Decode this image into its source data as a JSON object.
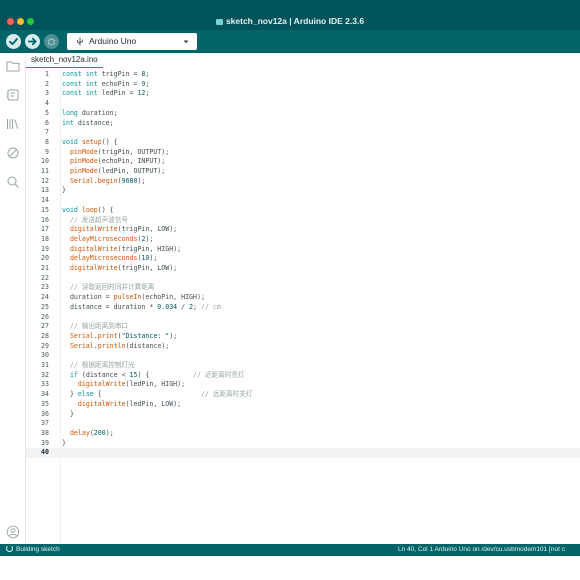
{
  "window": {
    "title": "sketch_nov12a | Arduino IDE 2.3.6"
  },
  "toolbar": {
    "verify_icon": "check-icon",
    "upload_icon": "arrow-right-icon",
    "debug_icon": "debug-icon",
    "board_label": "Arduino Uno"
  },
  "sidebar": {
    "items": [
      {
        "icon": "folder-icon"
      },
      {
        "icon": "board-manager-icon"
      },
      {
        "icon": "library-icon"
      },
      {
        "icon": "debug-icon"
      },
      {
        "icon": "search-icon"
      }
    ],
    "bottom_icon": "account-icon"
  },
  "tabs": [
    {
      "label": "sketch_nov12a.ino"
    }
  ],
  "editor": {
    "active_line": 40,
    "lines": [
      {
        "n": "1",
        "tokens": [
          [
            "kw",
            "const int"
          ],
          [
            "pl",
            " trigPin = "
          ],
          [
            "num",
            "8"
          ],
          [
            "pl",
            ";"
          ]
        ]
      },
      {
        "n": "2",
        "tokens": [
          [
            "kw",
            "const int"
          ],
          [
            "pl",
            " echoPin = "
          ],
          [
            "num",
            "9"
          ],
          [
            "pl",
            ";"
          ]
        ]
      },
      {
        "n": "3",
        "tokens": [
          [
            "kw",
            "const int"
          ],
          [
            "pl",
            " ledPin = "
          ],
          [
            "num",
            "12"
          ],
          [
            "pl",
            ";"
          ]
        ]
      },
      {
        "n": "4",
        "tokens": []
      },
      {
        "n": "5",
        "tokens": [
          [
            "kw",
            "long"
          ],
          [
            "pl",
            " duration;"
          ]
        ]
      },
      {
        "n": "6",
        "tokens": [
          [
            "kw",
            "int"
          ],
          [
            "pl",
            " distance;"
          ]
        ]
      },
      {
        "n": "7",
        "tokens": []
      },
      {
        "n": "8",
        "tokens": [
          [
            "kw",
            "void"
          ],
          [
            "pl",
            " "
          ],
          [
            "fn",
            "setup"
          ],
          [
            "pl",
            "() {"
          ]
        ]
      },
      {
        "n": "9",
        "tokens": [
          [
            "pl",
            "  "
          ],
          [
            "fn",
            "pinMode"
          ],
          [
            "pl",
            "(trigPin, OUTPUT);"
          ]
        ]
      },
      {
        "n": "10",
        "tokens": [
          [
            "pl",
            "  "
          ],
          [
            "fn",
            "pinMode"
          ],
          [
            "pl",
            "(echoPin, INPUT);"
          ]
        ]
      },
      {
        "n": "11",
        "tokens": [
          [
            "pl",
            "  "
          ],
          [
            "fn",
            "pinMode"
          ],
          [
            "pl",
            "(ledPin, OUTPUT);"
          ]
        ]
      },
      {
        "n": "12",
        "tokens": [
          [
            "pl",
            "  "
          ],
          [
            "fn",
            "Serial"
          ],
          [
            "pl",
            "."
          ],
          [
            "fn",
            "begin"
          ],
          [
            "pl",
            "("
          ],
          [
            "num",
            "9600"
          ],
          [
            "pl",
            ");"
          ]
        ]
      },
      {
        "n": "13",
        "tokens": [
          [
            "pl",
            "}"
          ]
        ]
      },
      {
        "n": "14",
        "tokens": []
      },
      {
        "n": "15",
        "tokens": [
          [
            "kw",
            "void"
          ],
          [
            "pl",
            " "
          ],
          [
            "fn",
            "loop"
          ],
          [
            "pl",
            "() {"
          ]
        ]
      },
      {
        "n": "16",
        "tokens": [
          [
            "pl",
            "  "
          ],
          [
            "cm",
            "// 发送超声波信号"
          ]
        ]
      },
      {
        "n": "17",
        "tokens": [
          [
            "pl",
            "  "
          ],
          [
            "fn",
            "digitalWrite"
          ],
          [
            "pl",
            "(trigPin, LOW);"
          ]
        ]
      },
      {
        "n": "18",
        "tokens": [
          [
            "pl",
            "  "
          ],
          [
            "fn",
            "delayMicroseconds"
          ],
          [
            "pl",
            "("
          ],
          [
            "num",
            "2"
          ],
          [
            "pl",
            ");"
          ]
        ]
      },
      {
        "n": "19",
        "tokens": [
          [
            "pl",
            "  "
          ],
          [
            "fn",
            "digitalWrite"
          ],
          [
            "pl",
            "(trigPin, HIGH);"
          ]
        ]
      },
      {
        "n": "20",
        "tokens": [
          [
            "pl",
            "  "
          ],
          [
            "fn",
            "delayMicroseconds"
          ],
          [
            "pl",
            "("
          ],
          [
            "num",
            "10"
          ],
          [
            "pl",
            ");"
          ]
        ]
      },
      {
        "n": "21",
        "tokens": [
          [
            "pl",
            "  "
          ],
          [
            "fn",
            "digitalWrite"
          ],
          [
            "pl",
            "(trigPin, LOW);"
          ]
        ]
      },
      {
        "n": "22",
        "tokens": []
      },
      {
        "n": "23",
        "tokens": [
          [
            "pl",
            "  "
          ],
          [
            "cm",
            "// 读取返回时间并计算距离"
          ]
        ]
      },
      {
        "n": "24",
        "tokens": [
          [
            "pl",
            "  duration = "
          ],
          [
            "fn",
            "pulseIn"
          ],
          [
            "pl",
            "(echoPin, HIGH);"
          ]
        ]
      },
      {
        "n": "25",
        "tokens": [
          [
            "pl",
            "  distance = duration * "
          ],
          [
            "num",
            "0.034"
          ],
          [
            "pl",
            " / "
          ],
          [
            "num",
            "2"
          ],
          [
            "pl",
            "; "
          ],
          [
            "cm",
            "// cm"
          ]
        ]
      },
      {
        "n": "26",
        "tokens": []
      },
      {
        "n": "27",
        "tokens": [
          [
            "pl",
            "  "
          ],
          [
            "cm",
            "// 输出距离到串口"
          ]
        ]
      },
      {
        "n": "28",
        "tokens": [
          [
            "pl",
            "  "
          ],
          [
            "fn",
            "Serial"
          ],
          [
            "pl",
            "."
          ],
          [
            "fn",
            "print"
          ],
          [
            "pl",
            "("
          ],
          [
            "str",
            "\"Distance: \""
          ],
          [
            "pl",
            ");"
          ]
        ]
      },
      {
        "n": "29",
        "tokens": [
          [
            "pl",
            "  "
          ],
          [
            "fn",
            "Serial"
          ],
          [
            "pl",
            "."
          ],
          [
            "fn",
            "println"
          ],
          [
            "pl",
            "(distance);"
          ]
        ]
      },
      {
        "n": "30",
        "tokens": []
      },
      {
        "n": "31",
        "tokens": [
          [
            "pl",
            "  "
          ],
          [
            "cm",
            "// 根据距离控制灯光"
          ]
        ]
      },
      {
        "n": "32",
        "tokens": [
          [
            "pl",
            "  "
          ],
          [
            "kw",
            "if"
          ],
          [
            "pl",
            " (distance < "
          ],
          [
            "num",
            "15"
          ],
          [
            "pl",
            ") {           "
          ],
          [
            "cm",
            "// 近距离时亮灯"
          ]
        ]
      },
      {
        "n": "33",
        "tokens": [
          [
            "pl",
            "    "
          ],
          [
            "fn",
            "digitalWrite"
          ],
          [
            "pl",
            "(ledPin, HIGH);"
          ]
        ]
      },
      {
        "n": "34",
        "tokens": [
          [
            "pl",
            "  } "
          ],
          [
            "kw",
            "else"
          ],
          [
            "pl",
            " {                         "
          ],
          [
            "cm",
            "// 远距离时关灯"
          ]
        ]
      },
      {
        "n": "35",
        "tokens": [
          [
            "pl",
            "    "
          ],
          [
            "fn",
            "digitalWrite"
          ],
          [
            "pl",
            "(ledPin, LOW);"
          ]
        ]
      },
      {
        "n": "36",
        "tokens": [
          [
            "pl",
            "  }"
          ]
        ]
      },
      {
        "n": "37",
        "tokens": []
      },
      {
        "n": "38",
        "tokens": [
          [
            "pl",
            "  "
          ],
          [
            "fn",
            "delay"
          ],
          [
            "pl",
            "("
          ],
          [
            "num",
            "200"
          ],
          [
            "pl",
            ");"
          ]
        ]
      },
      {
        "n": "39",
        "tokens": [
          [
            "pl",
            "}"
          ]
        ]
      },
      {
        "n": "40",
        "tokens": []
      }
    ]
  },
  "status": {
    "left": "Building sketch",
    "right": "Ln 40, Col 1   Arduino Uno on /dev/cu.usbmodem101 [not c"
  },
  "colors": {
    "titlebar": "#00525b",
    "toolbar": "#006468",
    "accent": "#00979d",
    "keyword": "#00979c",
    "function": "#d35400",
    "comment": "#95a5a6"
  }
}
